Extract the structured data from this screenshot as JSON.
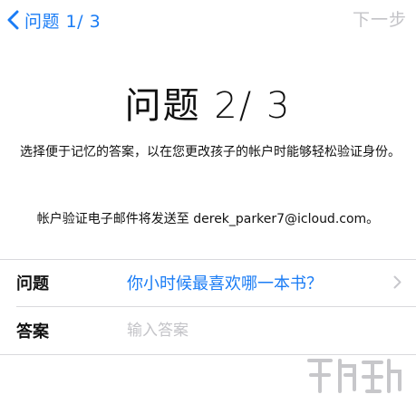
{
  "nav": {
    "back_label": "问题 1/ 3",
    "next_label": "下一步"
  },
  "title": "问题 2/ 3",
  "description": "选择便于记忆的答案，以在您更改孩子的帐户时能够轻松验证身份。",
  "email_note": "帐户验证电子邮件将发送至 derek_parker7@icloud.com。",
  "form": {
    "question_label": "问题",
    "question_value": "你小时候最喜欢哪一本书？",
    "answer_label": "答案",
    "answer_placeholder": "输入答案"
  },
  "colors": {
    "accent": "#1a7cf5",
    "disabled": "#c3c3c7",
    "separator": "#d9d9dd"
  },
  "icons": {
    "back": "chevron-left-icon",
    "disclosure": "chevron-right-icon"
  }
}
